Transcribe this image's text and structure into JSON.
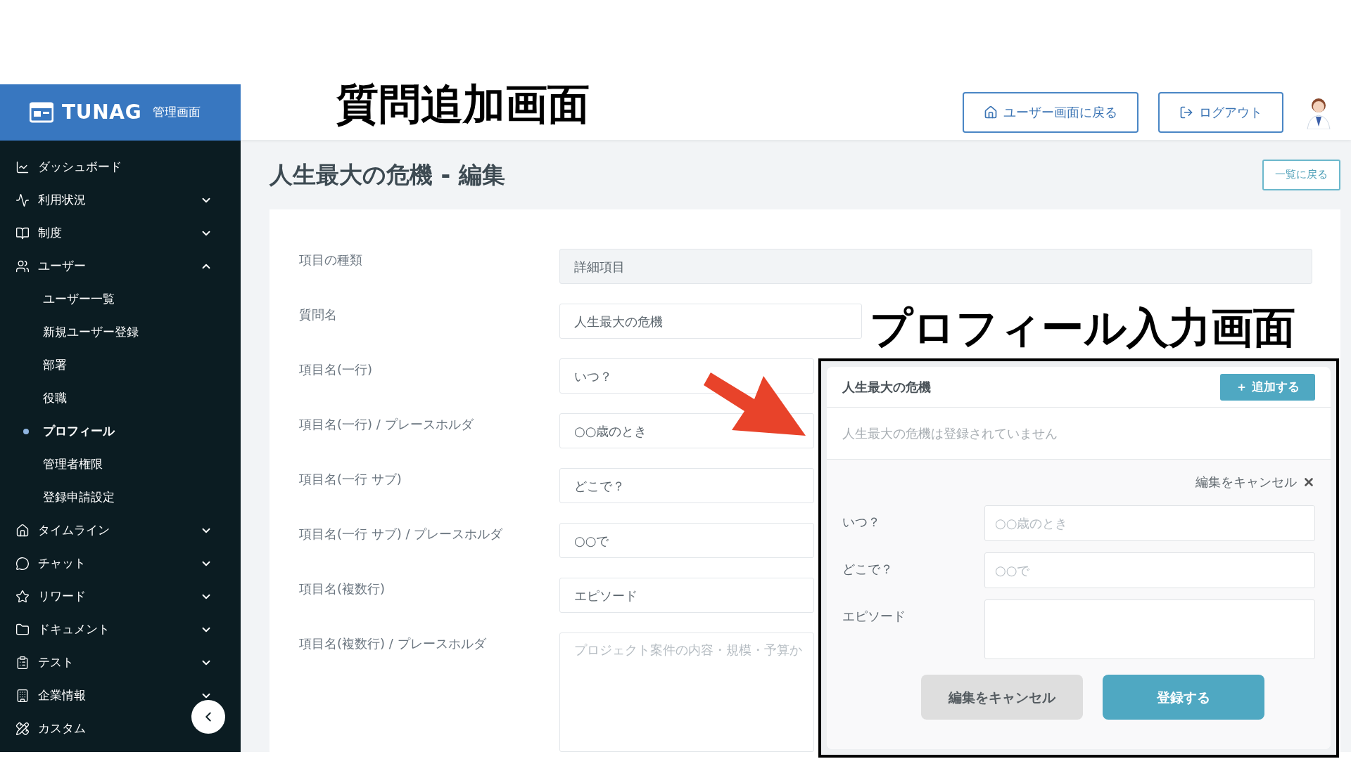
{
  "annotations": {
    "screen_title": "質問追加画面",
    "panel_title": "プロフィール入力画面"
  },
  "sidebar": {
    "logo": "TUNAG",
    "subtitle": "管理画面",
    "items": [
      {
        "label": "ダッシュボード",
        "kind": "link"
      },
      {
        "label": "利用状況",
        "kind": "group",
        "expanded": false
      },
      {
        "label": "制度",
        "kind": "group",
        "expanded": false
      },
      {
        "label": "ユーザー",
        "kind": "group",
        "expanded": true,
        "children": [
          {
            "label": "ユーザー一覧",
            "selected": false
          },
          {
            "label": "新規ユーザー登録",
            "selected": false
          },
          {
            "label": "部署",
            "selected": false
          },
          {
            "label": "役職",
            "selected": false
          },
          {
            "label": "プロフィール",
            "selected": true
          },
          {
            "label": "管理者権限",
            "selected": false
          },
          {
            "label": "登録申請設定",
            "selected": false
          }
        ]
      },
      {
        "label": "タイムライン",
        "kind": "group",
        "expanded": false
      },
      {
        "label": "チャット",
        "kind": "group",
        "expanded": false
      },
      {
        "label": "リワード",
        "kind": "group",
        "expanded": false
      },
      {
        "label": "ドキュメント",
        "kind": "group",
        "expanded": false
      },
      {
        "label": "テスト",
        "kind": "group",
        "expanded": false
      },
      {
        "label": "企業情報",
        "kind": "group",
        "expanded": false
      },
      {
        "label": "カスタム",
        "kind": "link"
      }
    ]
  },
  "header": {
    "buttons": [
      "ユーザー画面に戻る",
      "ログアウト"
    ]
  },
  "page": {
    "title": "人生最大の危機 - 編集",
    "back_button": "一覧に戻る"
  },
  "form": [
    {
      "label": "項目の種類",
      "kind": "readonly",
      "value": "詳細項目"
    },
    {
      "label": "質問名",
      "kind": "input",
      "value": "人生最大の危機"
    },
    {
      "label": "項目名(一行)",
      "kind": "input",
      "value": "いつ？"
    },
    {
      "label": "項目名(一行) / プレースホルダ",
      "kind": "input",
      "value": "○○歳のとき"
    },
    {
      "label": "項目名(一行 サブ)",
      "kind": "input",
      "value": "どこで？"
    },
    {
      "label": "項目名(一行 サブ) / プレースホルダ",
      "kind": "input",
      "value": "○○で"
    },
    {
      "label": "項目名(複数行)",
      "kind": "input",
      "value": "エピソード"
    },
    {
      "label": "項目名(複数行) / プレースホルダ",
      "kind": "textarea",
      "placeholder": "プロジェクト案件の内容・規模・予算か"
    }
  ],
  "profile_panel": {
    "title": "人生最大の危機",
    "add_button": "＋ 追加する",
    "empty_message": "人生最大の危機は登録されていません",
    "cancel_link": "編集をキャンセル",
    "fields": [
      {
        "label": "いつ？",
        "kind": "input",
        "placeholder": "○○歳のとき"
      },
      {
        "label": "どこで？",
        "kind": "input",
        "placeholder": "○○で"
      },
      {
        "label": "エピソード",
        "kind": "textarea"
      }
    ],
    "buttons": [
      "編集をキャンセル",
      "登録する"
    ]
  }
}
